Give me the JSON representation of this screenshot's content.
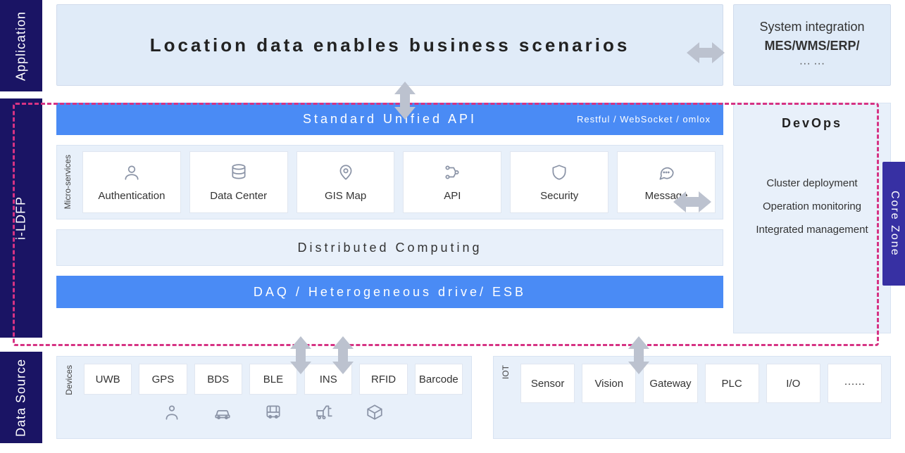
{
  "layers": {
    "application": {
      "label": "Application",
      "headline": "Location data enables business scenarios",
      "integration": {
        "line1": "System integration",
        "line2": "MES/WMS/ERP/",
        "line3": "··· ···"
      }
    },
    "ildfp": {
      "label": "i-LDFP",
      "api_bar": {
        "title": "Standard Unified API",
        "subtitle": "Restful / WebSocket / omlox"
      },
      "micro_label": "Micro-services",
      "services": [
        {
          "name": "Authentication",
          "icon": "user-icon"
        },
        {
          "name": "Data Center",
          "icon": "database-icon"
        },
        {
          "name": "GIS Map",
          "icon": "map-pin-icon"
        },
        {
          "name": "API",
          "icon": "api-icon"
        },
        {
          "name": "Security",
          "icon": "shield-icon"
        },
        {
          "name": "Message",
          "icon": "chat-icon"
        }
      ],
      "distributed": "Distributed Computing",
      "daq_bar": "DAQ / Heterogeneous drive/ ESB",
      "devops": {
        "title": "DevOps",
        "items": [
          "Cluster deployment",
          "Operation monitoring",
          "Integrated management"
        ]
      }
    },
    "datasource": {
      "label": "Data Source",
      "devices_label": "Devices",
      "devices": [
        "UWB",
        "GPS",
        "BDS",
        "BLE",
        "INS",
        "RFID",
        "Barcode"
      ],
      "device_icons": [
        "person-icon",
        "car-icon",
        "bus-icon",
        "forklift-icon",
        "box-icon"
      ],
      "iot_label": "IOT",
      "iot": [
        "Sensor",
        "Vision",
        "Gateway",
        "PLC",
        "I/O",
        "······"
      ]
    }
  },
  "corezone": "Core Zone"
}
